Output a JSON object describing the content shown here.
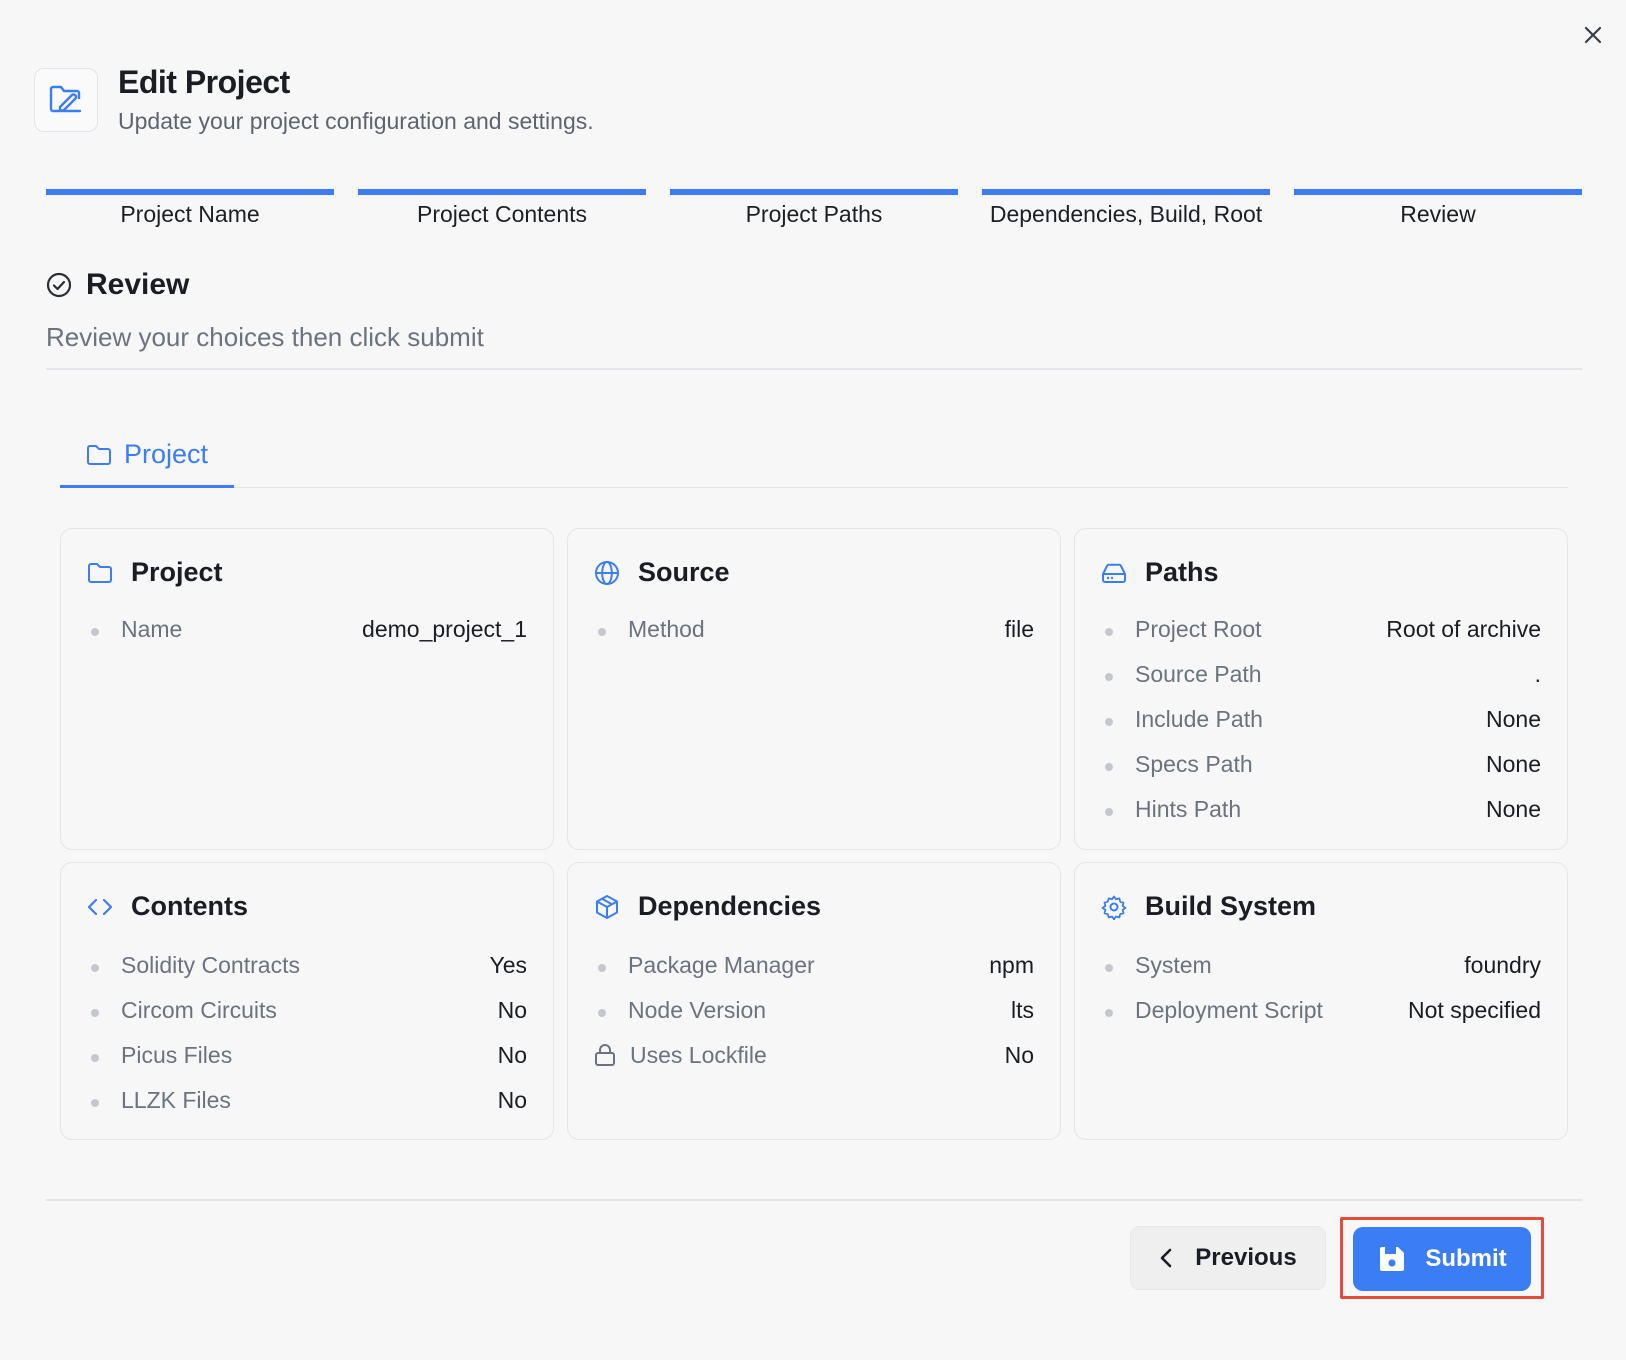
{
  "dialog": {
    "title": "Edit Project",
    "subtitle": "Update your project configuration and settings."
  },
  "steps": [
    "Project Name",
    "Project Contents",
    "Project Paths",
    "Dependencies, Build, Root",
    "Review"
  ],
  "section": {
    "title": "Review",
    "subtitle": "Review your choices then click submit"
  },
  "tab": {
    "label": "Project"
  },
  "cards": {
    "project": {
      "title": "Project",
      "rows": [
        {
          "label": "Name",
          "value": "demo_project_1"
        }
      ]
    },
    "source": {
      "title": "Source",
      "rows": [
        {
          "label": "Method",
          "value": "file"
        }
      ]
    },
    "paths": {
      "title": "Paths",
      "rows": [
        {
          "label": "Project Root",
          "value": "Root of archive"
        },
        {
          "label": "Source Path",
          "value": "."
        },
        {
          "label": "Include Path",
          "value": "None"
        },
        {
          "label": "Specs Path",
          "value": "None"
        },
        {
          "label": "Hints Path",
          "value": "None"
        }
      ]
    },
    "contents": {
      "title": "Contents",
      "rows": [
        {
          "label": "Solidity Contracts",
          "value": "Yes"
        },
        {
          "label": "Circom Circuits",
          "value": "No"
        },
        {
          "label": "Picus Files",
          "value": "No"
        },
        {
          "label": "LLZK Files",
          "value": "No"
        }
      ]
    },
    "dependencies": {
      "title": "Dependencies",
      "rows": [
        {
          "label": "Package Manager",
          "value": "npm"
        },
        {
          "label": "Node Version",
          "value": "lts"
        },
        {
          "label": "Uses Lockfile",
          "value": "No"
        }
      ]
    },
    "build": {
      "title": "Build System",
      "rows": [
        {
          "label": "System",
          "value": "foundry"
        },
        {
          "label": "Deployment Script",
          "value": "Not specified"
        }
      ]
    }
  },
  "footer": {
    "previous_label": "Previous",
    "submit_label": "Submit"
  },
  "colors": {
    "accent": "#3b7df5",
    "highlight": "#e24c3b",
    "background": "#f7f7f7"
  }
}
